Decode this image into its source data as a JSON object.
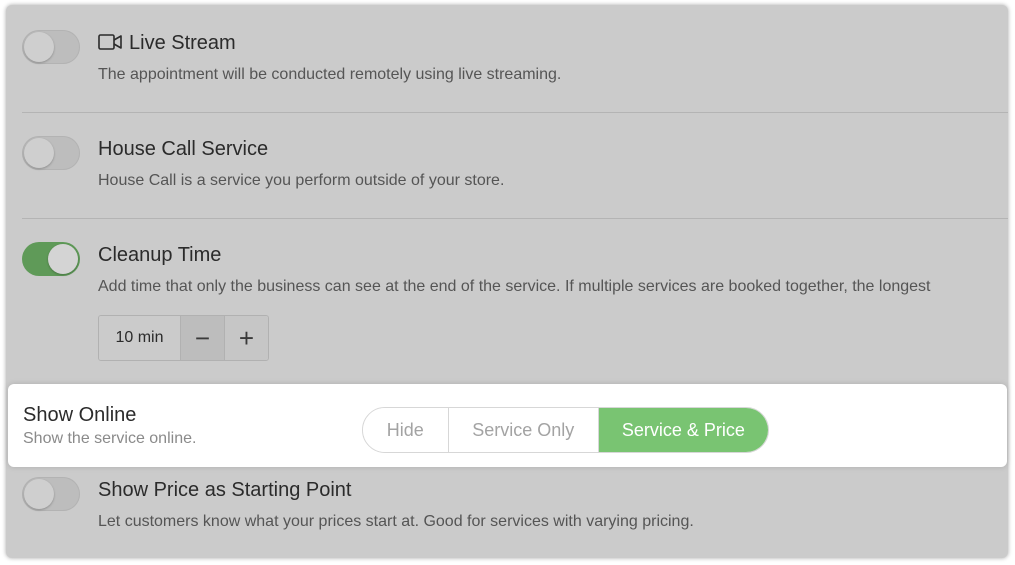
{
  "colors": {
    "panel_bg": "#cbcbcb",
    "toggle_on": "#5f9a58",
    "segment_active": "#79c472",
    "highlight_bg": "#ffffff"
  },
  "settings": [
    {
      "icon": "video-camera-icon",
      "title": "Live Stream",
      "description": "The appointment will be conducted remotely using live streaming.",
      "enabled": false
    },
    {
      "title": "House Call Service",
      "description": "House Call is a service you perform outside of your store.",
      "enabled": false
    },
    {
      "title": "Cleanup Time",
      "description": "Add time that only the business can see at the end of the service. If multiple services are booked together, the longest",
      "enabled": true,
      "stepper": {
        "value": "10 min",
        "decrement": "−",
        "increment": "+"
      }
    }
  ],
  "show_online": {
    "title": "Show Online",
    "description": "Show the service online.",
    "options": [
      "Hide",
      "Service Only",
      "Service & Price"
    ],
    "selected": "Service & Price"
  },
  "show_price": {
    "title": "Show Price as Starting Point",
    "description": "Let customers know what your prices start at. Good for services with varying pricing.",
    "enabled": false
  }
}
